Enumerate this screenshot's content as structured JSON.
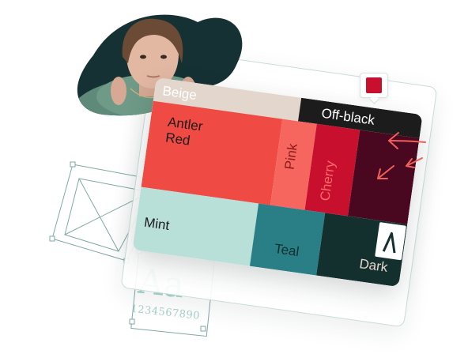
{
  "palette": {
    "swatches": [
      {
        "label": "Beige",
        "color": "#e3d6cd"
      },
      {
        "label": "Off-black",
        "color": "#1c1c1c"
      },
      {
        "label": "Antler Red",
        "color": "#ef4a44"
      },
      {
        "label": "Pink",
        "color": "#f7655f"
      },
      {
        "label": "Cherry",
        "color": "#c8102e"
      },
      {
        "label": "",
        "color": "#4a0820"
      },
      {
        "label": "Mint",
        "color": "#b8e0d8"
      },
      {
        "label": "Teal",
        "color": "#2a7f86"
      },
      {
        "label": "Dark",
        "color": "#13302f"
      }
    ],
    "antler_line1": "Antler",
    "antler_line2": "Red"
  },
  "pin": {
    "color": "#c8102e"
  },
  "specimen": {
    "glyphs": "Aa",
    "numerals": "1234567890"
  },
  "icons": {
    "pen": "pen-nib-icon",
    "arrows": "cursor-arrow-icon",
    "image_placeholder": "image-placeholder-icon"
  },
  "colors": {
    "accent_coral": "#f0605a",
    "wire": "#7fa9a4",
    "blob": "#163133"
  }
}
